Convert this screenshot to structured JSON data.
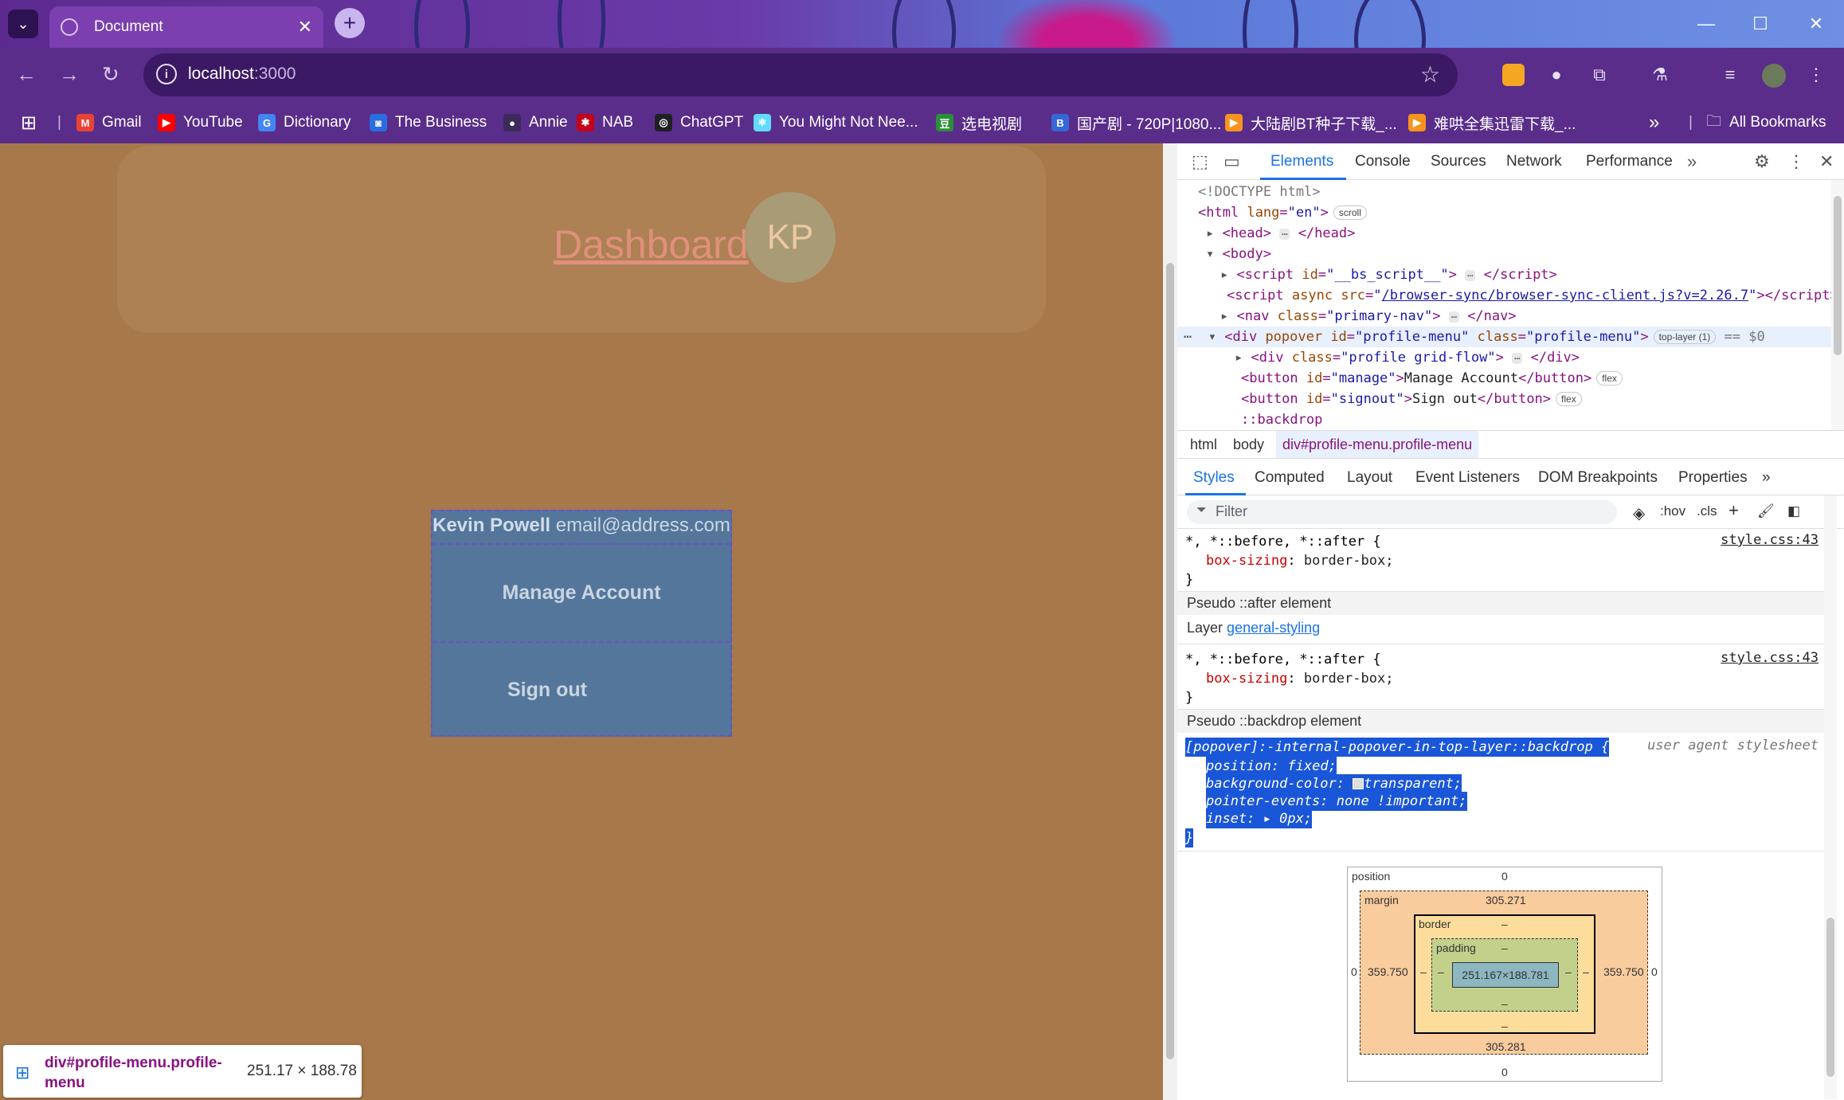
{
  "browser": {
    "tab_title": "Document",
    "url_host": "localhost",
    "url_port": ":3000",
    "bookmarks": [
      {
        "label": "Gmail",
        "color": "#ea4335",
        "glyph": "M"
      },
      {
        "label": "YouTube",
        "color": "#ff0000",
        "glyph": "▶"
      },
      {
        "label": "Dictionary",
        "color": "#4285f4",
        "glyph": "G"
      },
      {
        "label": "The Business",
        "color": "#2a6de0",
        "glyph": "◙"
      },
      {
        "label": "Annie",
        "color": "#3b2a5a",
        "glyph": "●"
      },
      {
        "label": "NAB",
        "color": "#c4001a",
        "glyph": "✱"
      },
      {
        "label": "ChatGPT",
        "color": "#202123",
        "glyph": "◎"
      },
      {
        "label": "You Might Not Nee...",
        "color": "#61dafb",
        "glyph": "⚛"
      },
      {
        "label": "选电视剧",
        "color": "#2b8f3a",
        "glyph": "豆"
      },
      {
        "label": "国产剧 - 720P|1080...",
        "color": "#3567d6",
        "glyph": "B"
      },
      {
        "label": "大陆剧BT种子下载_...",
        "color": "#f7941d",
        "glyph": "▶"
      },
      {
        "label": "难哄全集迅雷下载_...",
        "color": "#f7941d",
        "glyph": "▶"
      }
    ],
    "all_bookmarks": "All Bookmarks"
  },
  "page": {
    "dashboard_link": "Dashboard",
    "avatar_initials": "KP",
    "profile_name": "Kevin Powell",
    "profile_email": "email@address.com",
    "manage_button": "Manage Account",
    "signout_button": "Sign out"
  },
  "inspect_tooltip": {
    "selector": "div#profile-menu.profile-menu",
    "dimensions": "251.17 × 188.78"
  },
  "devtools": {
    "tabs": [
      "Elements",
      "Console",
      "Sources",
      "Network",
      "Performance"
    ],
    "active_tab": "Elements",
    "dom": {
      "doctype": "<!DOCTYPE html>",
      "html_open": "html",
      "html_lang_attr": "lang",
      "html_lang_val": "\"en\"",
      "scroll_badge": "scroll",
      "head": "head",
      "body": "body",
      "script1_id": "\"__bs_script__\"",
      "script2_src": "/browser-sync/browser-sync-client.js?v=2.26.7",
      "nav_class": "\"primary-nav\"",
      "popover_id": "\"profile-menu\"",
      "popover_class": "\"profile-menu\"",
      "top_layer_badge": "top-layer (1)",
      "dollar_zero": "== $0",
      "inner_div_class": "\"profile grid-flow\"",
      "manage_id": "\"manage\"",
      "manage_text": "Manage Account",
      "signout_id": "\"signout\"",
      "signout_text": "Sign out",
      "flex_badge": "flex",
      "backdrop": "::backdrop"
    },
    "breadcrumbs": [
      "html",
      "body",
      "div#profile-menu.profile-menu"
    ],
    "subtabs": [
      "Styles",
      "Computed",
      "Layout",
      "Event Listeners",
      "DOM Breakpoints",
      "Properties"
    ],
    "filter_placeholder": "Filter",
    "hov": ":hov",
    "cls": ".cls",
    "styles": {
      "rule1_selector": "*, *::before, *::after {",
      "rule1_source": "style.css:43",
      "prop_box_sizing": "box-sizing",
      "val_border_box": "border-box;",
      "pseudo_after": "Pseudo ::after element",
      "layer_label": "Layer",
      "layer_name": "general-styling",
      "rule2_selector": "*, *::before, *::after {",
      "rule2_source": "style.css:43",
      "pseudo_backdrop": "Pseudo ::backdrop element",
      "ua_selector": "[popover]:-internal-popover-in-top-layer::backdrop {",
      "ua_source": "user agent stylesheet",
      "ua_props": [
        {
          "prop": "position",
          "val": "fixed;"
        },
        {
          "prop": "background-color",
          "val": "transparent;"
        },
        {
          "prop": "pointer-events",
          "val": "none !important;"
        },
        {
          "prop": "inset",
          "val": "0px;"
        }
      ]
    },
    "box_model": {
      "position_label": "position",
      "position_top": "0",
      "position_bottom": "0",
      "position_left": "0",
      "position_right": "0",
      "margin_label": "margin",
      "margin_top": "305.271",
      "margin_bottom": "305.281",
      "margin_left": "359.750",
      "margin_right": "359.750",
      "border_label": "border",
      "border_value": "–",
      "padding_label": "padding",
      "padding_value": "–",
      "content": "251.167×188.781"
    }
  }
}
